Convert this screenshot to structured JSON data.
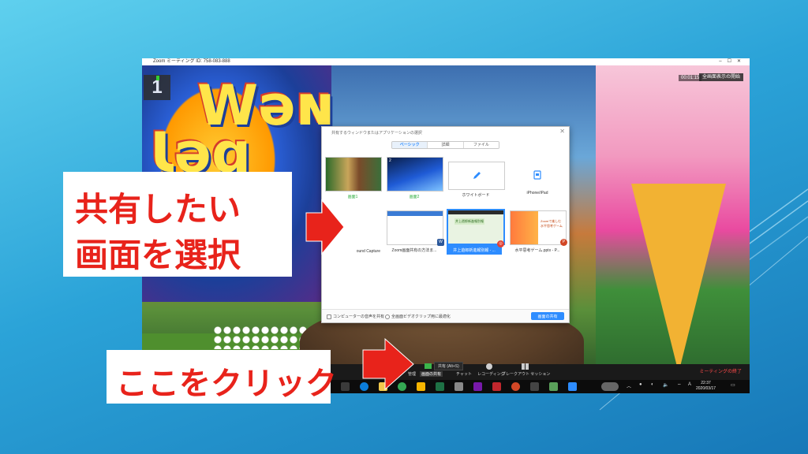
{
  "window": {
    "title": "Zoom ミーティング ID: 758-083-888",
    "elapsed": "00:01:15",
    "fullscreen_label": "全画面表示の開始"
  },
  "share_dialog": {
    "title": "共有するウィンドウまたはアプリケーションの選択",
    "tabs": [
      {
        "label": "ベーシック",
        "active": true
      },
      {
        "label": "詳細",
        "active": false
      },
      {
        "label": "ファイル",
        "active": false
      }
    ],
    "items": [
      {
        "label": "画面1",
        "number": ""
      },
      {
        "label": "画面2",
        "number": "2"
      },
      {
        "label": "ホワイトボード"
      },
      {
        "label": "iPhone/iPad"
      },
      {
        "label": "ound Capture"
      },
      {
        "label": "Zoom画面共有の方法ま..."
      },
      {
        "label": "井上遊郎新進報別報 - ..."
      },
      {
        "label": "水平思考ゲーム.pptx - P..."
      }
    ],
    "slide_text": "Zoomで楽しむ水平思考ゲーム",
    "page_banner": "井上遊郎新進報別報",
    "option_sound": "コンピューターの音声を共有",
    "option_optimize": "全画面ビデオクリップ用に最適化",
    "share_button": "画面の共有"
  },
  "toolbar": {
    "tooltip": "共有 (Alt+S)",
    "manage": "管理",
    "share_screen": "画面の共有",
    "chat": "チャット",
    "record": "レコーディング",
    "breakout": "ブレークアウト セッション",
    "end_meeting": "ミーティングの終了"
  },
  "taskbar": {
    "time": "22:37",
    "date": "2020/03/17",
    "ime": "A"
  },
  "video": {
    "participant_number": "1"
  },
  "callouts": {
    "share_line1": "共有したい",
    "share_line2": "画面を選択",
    "click_here": "ここをクリック"
  },
  "colors": {
    "callout_red": "#e8231b",
    "zoom_blue": "#2d8cff",
    "active_green": "#2fae3f"
  }
}
